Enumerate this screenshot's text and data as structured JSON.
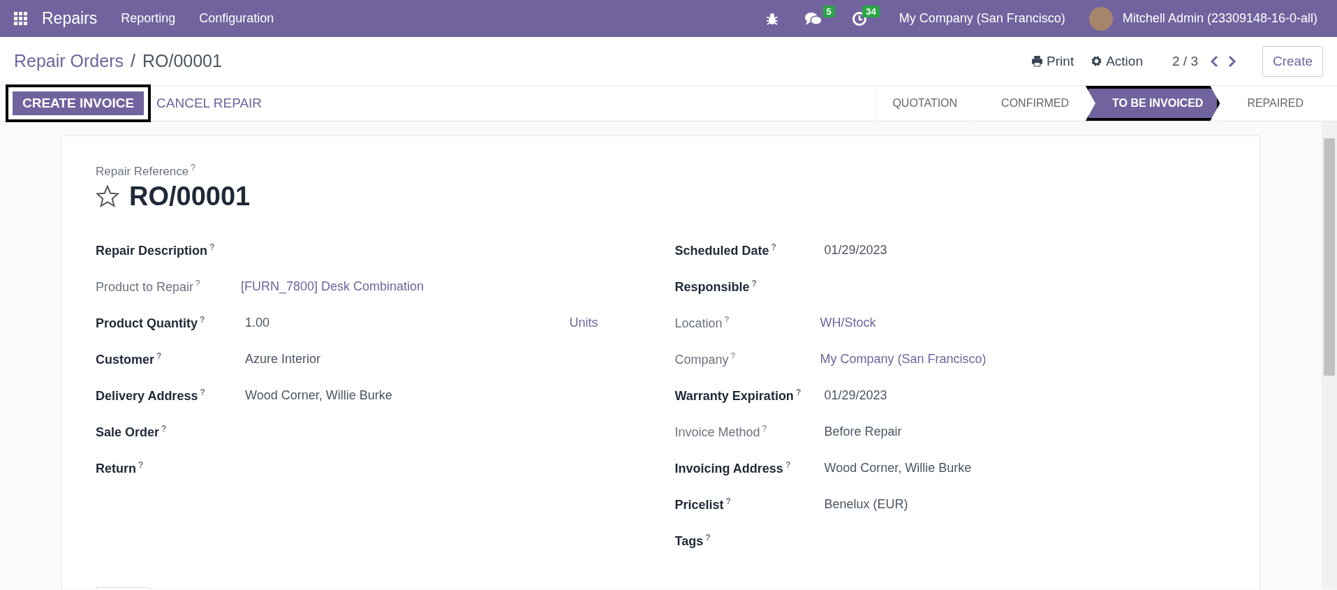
{
  "navbar": {
    "app_name": "Repairs",
    "menu": [
      "Reporting",
      "Configuration"
    ],
    "messages_count": "5",
    "activities_count": "34",
    "company": "My Company (San Francisco)",
    "user": "Mitchell Admin (23309148-16-0-all)"
  },
  "breadcrumb": {
    "parent": "Repair Orders",
    "separator": "/",
    "current": "RO/00001"
  },
  "control_panel": {
    "print": "Print",
    "action": "Action",
    "pager": "2 / 3",
    "create": "Create"
  },
  "actions": [
    {
      "label": "CREATE INVOICE",
      "kind": "primary",
      "highlighted": true
    },
    {
      "label": "CANCEL REPAIR",
      "kind": "link",
      "highlighted": false
    }
  ],
  "status_steps": [
    {
      "label": "QUOTATION",
      "selected": false,
      "highlighted": false
    },
    {
      "label": "CONFIRMED",
      "selected": false,
      "highlighted": false
    },
    {
      "label": "TO BE INVOICED",
      "selected": true,
      "highlighted": true
    },
    {
      "label": "REPAIRED",
      "selected": false,
      "highlighted": false
    }
  ],
  "form": {
    "reference_label": "Repair Reference",
    "help": "?",
    "favorite": false,
    "reference": "RO/00001",
    "left_fields": [
      {
        "label": "Repair Description",
        "readonly": false
      },
      {
        "label": "Product to Repair",
        "readonly": true,
        "value": "[FURN_7800] Desk Combination",
        "link": true
      },
      {
        "label": "Product Quantity",
        "readonly": false,
        "value": "1.00",
        "link": false,
        "unit": "Units"
      },
      {
        "label": "Customer",
        "readonly": false,
        "value": "Azure Interior",
        "link": false
      },
      {
        "label": "Delivery Address",
        "readonly": false,
        "value": "Wood Corner, Willie Burke",
        "link": false
      },
      {
        "label": "Sale Order",
        "readonly": false
      },
      {
        "label": "Return",
        "readonly": false
      }
    ],
    "right_fields": [
      {
        "label": "Scheduled Date",
        "readonly": false,
        "value": "01/29/2023",
        "link": false
      },
      {
        "label": "Responsible",
        "readonly": false
      },
      {
        "label": "Location",
        "readonly": true,
        "value": "WH/Stock",
        "link": true
      },
      {
        "label": "Company",
        "readonly": true,
        "value": "My Company (San Francisco)",
        "link": true
      },
      {
        "label": "Warranty Expiration",
        "readonly": false,
        "value": "01/29/2023",
        "link": false
      },
      {
        "label": "Invoice Method",
        "readonly": true,
        "value": "Before Repair",
        "link": false
      },
      {
        "label": "Invoicing Address",
        "readonly": false,
        "value": "Wood Corner, Willie Burke",
        "link": false
      },
      {
        "label": "Pricelist",
        "readonly": false,
        "value": "Benelux (EUR)",
        "link": false
      },
      {
        "label": "Tags",
        "readonly": false
      }
    ]
  }
}
